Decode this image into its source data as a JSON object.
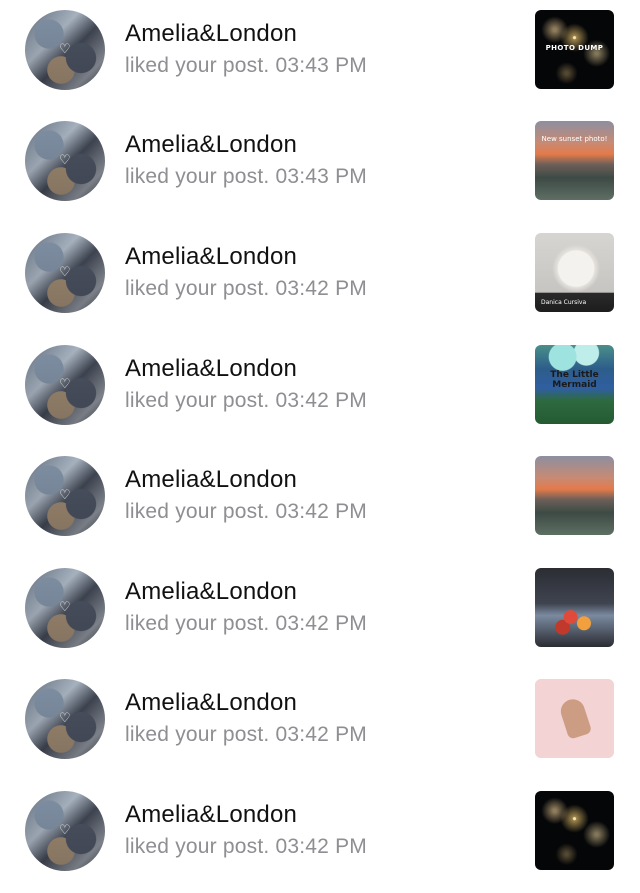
{
  "notifications": [
    {
      "user": "Amelia&London",
      "action": "liked your post.",
      "time": "03:43 PM",
      "thumb": "fireworks",
      "thumb_text": "PHOTO DUMP"
    },
    {
      "user": "Amelia&London",
      "action": "liked your post.",
      "time": "03:43 PM",
      "thumb": "sunset",
      "thumb_text": "New sunset photo!"
    },
    {
      "user": "Amelia&London",
      "action": "liked your post.",
      "time": "03:42 PM",
      "thumb": "dog",
      "thumb_text": "Danica Cursiva"
    },
    {
      "user": "Amelia&London",
      "action": "liked your post.",
      "time": "03:42 PM",
      "thumb": "mermaid",
      "thumb_text": "The Little Mermaid"
    },
    {
      "user": "Amelia&London",
      "action": "liked your post.",
      "time": "03:42 PM",
      "thumb": "sunset",
      "thumb_text": ""
    },
    {
      "user": "Amelia&London",
      "action": "liked your post.",
      "time": "03:42 PM",
      "thumb": "fruit",
      "thumb_text": ""
    },
    {
      "user": "Amelia&London",
      "action": "liked your post.",
      "time": "03:42 PM",
      "thumb": "pink",
      "thumb_text": ""
    },
    {
      "user": "Amelia&London",
      "action": "liked your post.",
      "time": "03:42 PM",
      "thumb": "fireworks",
      "thumb_text": ""
    }
  ],
  "avatar_icon": "heart-icon"
}
